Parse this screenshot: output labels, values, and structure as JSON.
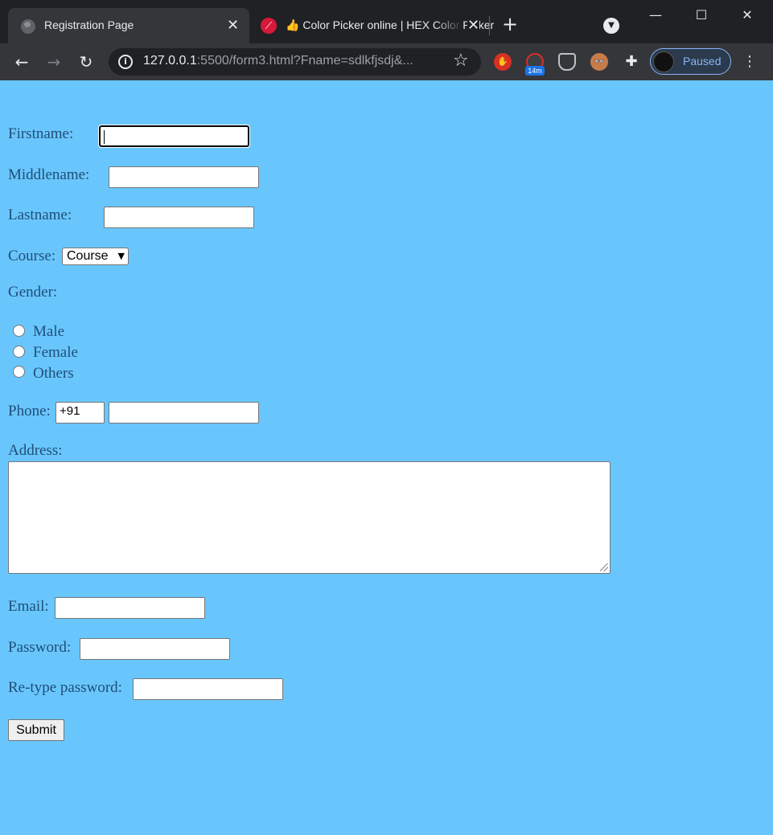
{
  "browser": {
    "tabs": [
      {
        "title": "Registration Page",
        "active": true
      },
      {
        "title": "Color Picker online | HEX Color Picker",
        "favicon": "👍"
      }
    ],
    "new_tab_label": "+",
    "address": {
      "host": "127.0.0.1",
      "rest": ":5500/form3.html?Fname=sdlkfjsdj&..."
    },
    "extension_badge": "14m",
    "profile_label": "Paused",
    "icons": [
      "back-icon",
      "forward-icon",
      "reload-icon",
      "info-icon",
      "star-icon",
      "extensions-icon",
      "menu-icon"
    ]
  },
  "form": {
    "firstname_label": "Firstname:",
    "middlename_label": "Middlename:",
    "lastname_label": "Lastname:",
    "course_label": "Course:",
    "course_selected": "Course",
    "gender_label": "Gender:",
    "gender_options": [
      "Male",
      "Female",
      "Others"
    ],
    "phone_label": "Phone:",
    "phone_code": "+91",
    "address_label": "Address:",
    "email_label": "Email:",
    "password_label": "Password:",
    "retype_label": "Re-type password:",
    "submit_label": "Submit"
  },
  "colors": {
    "page_background": "#69c6fc",
    "label_text": "#1f4e79"
  }
}
